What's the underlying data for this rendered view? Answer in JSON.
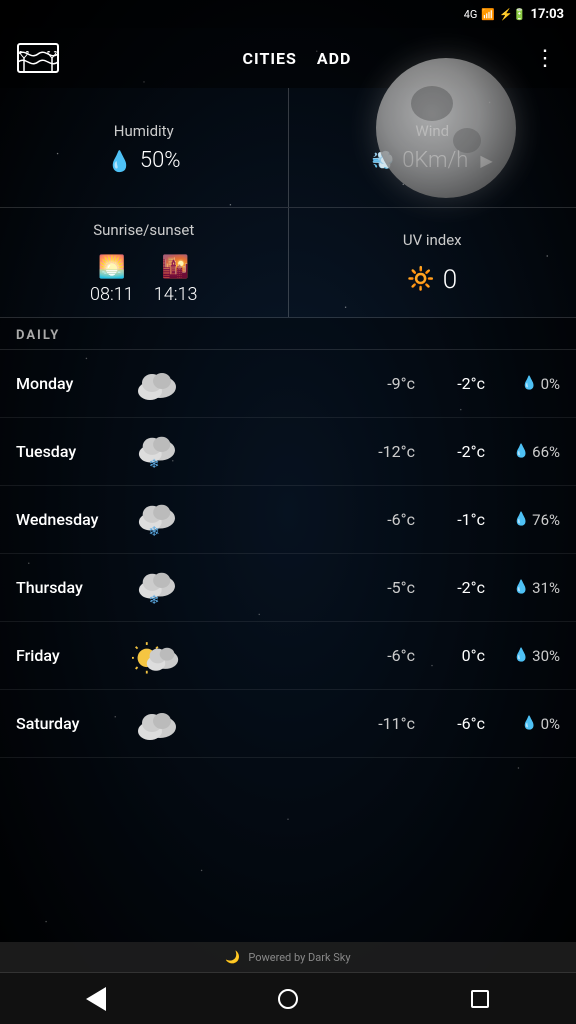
{
  "statusBar": {
    "network": "4G",
    "time": "17:03",
    "batteryIcon": "🔋"
  },
  "header": {
    "logoAlt": "map-logo",
    "citiesLabel": "CITIES",
    "addLabel": "ADD",
    "menuIcon": "⋮"
  },
  "humidity": {
    "label": "Humidity",
    "value": "50%",
    "icon": "💧"
  },
  "wind": {
    "label": "Wind",
    "value": "0Km/h",
    "arrow": "▶"
  },
  "sunrise": {
    "label": "Sunrise/sunset",
    "riseTime": "08:11",
    "setTime": "14:13"
  },
  "uv": {
    "label": "UV index",
    "value": "0"
  },
  "daily": {
    "sectionLabel": "DAILY",
    "rows": [
      {
        "day": "Monday",
        "iconType": "cloud",
        "low": "-9°c",
        "high": "-2°c",
        "precip": "0%"
      },
      {
        "day": "Tuesday",
        "iconType": "snow",
        "low": "-12°c",
        "high": "-2°c",
        "precip": "66%"
      },
      {
        "day": "Wednesday",
        "iconType": "snow",
        "low": "-6°c",
        "high": "-1°c",
        "precip": "76%"
      },
      {
        "day": "Thursday",
        "iconType": "snow",
        "low": "-5°c",
        "high": "-2°c",
        "precip": "31%"
      },
      {
        "day": "Friday",
        "iconType": "partlycloudy",
        "low": "-6°c",
        "high": "0°c",
        "precip": "30%"
      },
      {
        "day": "Saturday",
        "iconType": "cloud",
        "low": "-11°c",
        "high": "-6°c",
        "precip": "0%"
      }
    ]
  },
  "footer": {
    "text": "Powered by Dark Sky"
  },
  "nav": {
    "backLabel": "back",
    "homeLabel": "home",
    "recentLabel": "recent"
  }
}
